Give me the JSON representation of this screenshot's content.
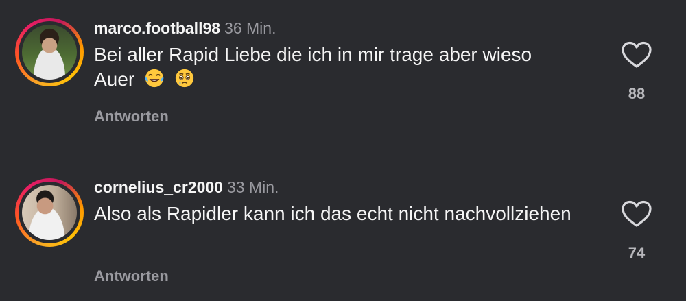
{
  "comments": [
    {
      "username": "marco.football98",
      "time": "36 Min.",
      "text": "Bei aller Rapid Liebe die ich in mir trage aber wieso Auer",
      "emojis": [
        "face-with-tears-of-joy-emoji",
        "face-holding-back-tears-emoji"
      ],
      "reply_label": "Antworten",
      "likes": "88",
      "like_icon": "heart-outline-icon"
    },
    {
      "username": "cornelius_cr2000",
      "time": "33 Min.",
      "text": "Also als Rapidler kann ich das echt nicht nachvollziehen",
      "emojis": [],
      "reply_label": "Antworten",
      "likes": "74",
      "like_icon": "heart-outline-icon"
    }
  ],
  "colors": {
    "background": "#2a2b2f",
    "secondary_text": "#9a9aa0",
    "story_ring": [
      "#f9a825",
      "#e91e63"
    ]
  }
}
